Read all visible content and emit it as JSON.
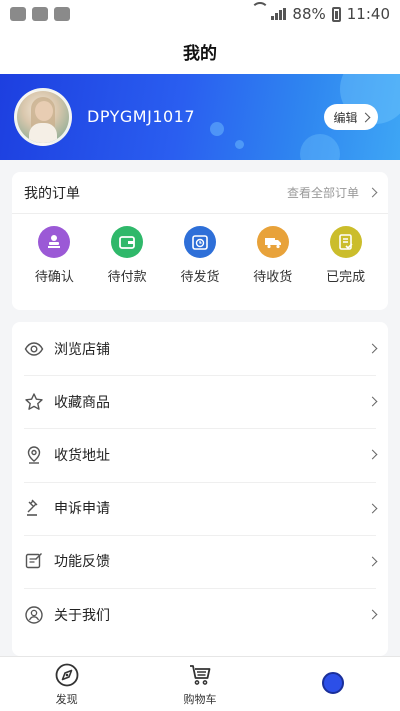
{
  "status_bar": {
    "battery": "88%",
    "time": "11:40"
  },
  "header": {
    "title": "我的"
  },
  "profile": {
    "username": "DPYGMJ1017",
    "edit_label": "编辑"
  },
  "orders": {
    "title": "我的订单",
    "view_all": "查看全部订单",
    "items": [
      {
        "label": "待确认",
        "icon": "stamp-icon",
        "color": "#9b59d6"
      },
      {
        "label": "待付款",
        "icon": "wallet-icon",
        "color": "#2fb86a"
      },
      {
        "label": "待发货",
        "icon": "package-clock-icon",
        "color": "#2e6fd8"
      },
      {
        "label": "待收货",
        "icon": "truck-icon",
        "color": "#e8a23a"
      },
      {
        "label": "已完成",
        "icon": "checklist-icon",
        "color": "#cbbd2b"
      }
    ]
  },
  "menu": {
    "items": [
      {
        "label": "浏览店铺",
        "icon": "eye-icon"
      },
      {
        "label": "收藏商品",
        "icon": "star-icon"
      },
      {
        "label": "收货地址",
        "icon": "location-icon"
      },
      {
        "label": "申诉申请",
        "icon": "gavel-icon"
      },
      {
        "label": "功能反馈",
        "icon": "feedback-icon"
      },
      {
        "label": "关于我们",
        "icon": "user-circle-icon"
      }
    ]
  },
  "tabbar": {
    "items": [
      {
        "label": "发现",
        "icon": "compass-icon"
      },
      {
        "label": "购物车",
        "icon": "cart-icon"
      },
      {
        "label": "",
        "icon": "profile-icon"
      }
    ]
  }
}
